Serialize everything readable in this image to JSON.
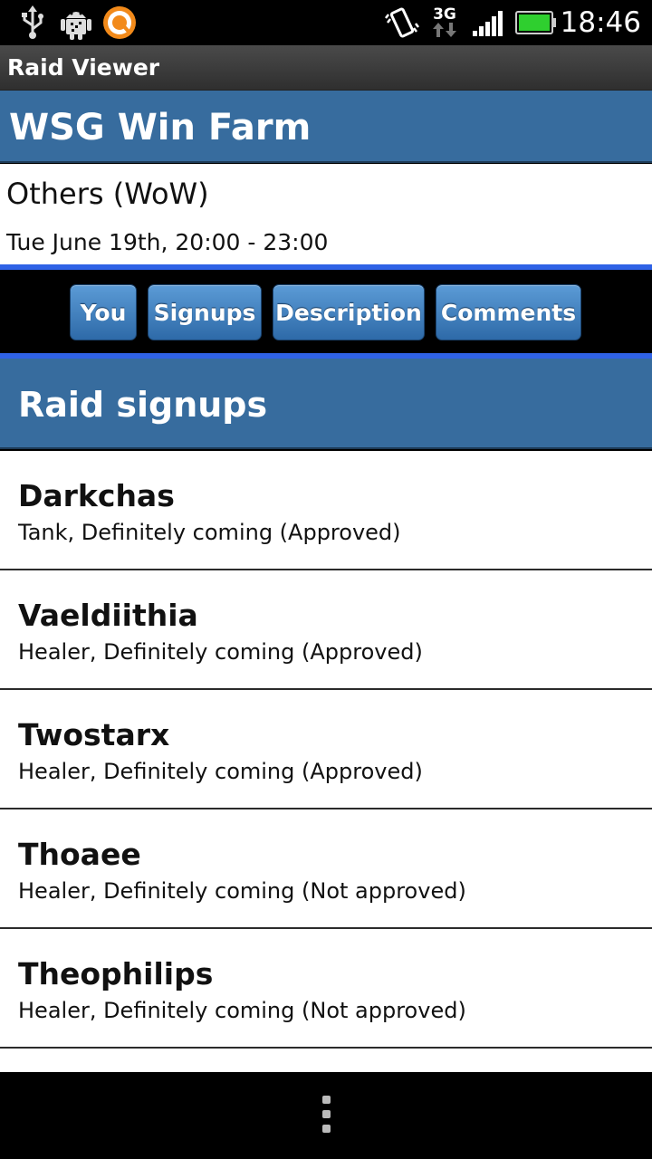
{
  "status_bar": {
    "icons": [
      "usb-icon",
      "android-debug-icon",
      "app-notification-icon",
      "vibrate-icon",
      "network-3g-icon",
      "signal-icon",
      "battery-icon"
    ],
    "network_label": "3G",
    "time": "18:46"
  },
  "app": {
    "title": "Raid Viewer"
  },
  "event": {
    "title": "WSG Win Farm",
    "game": "Others (WoW)",
    "datetime": "Tue June 19th, 20:00 - 23:00"
  },
  "tabs": [
    {
      "label": "You"
    },
    {
      "label": "Signups"
    },
    {
      "label": "Description"
    },
    {
      "label": "Comments"
    }
  ],
  "section": {
    "title": "Raid signups"
  },
  "signups": [
    {
      "name": "Darkchas",
      "status": "Tank, Definitely coming (Approved)"
    },
    {
      "name": "Vaeldiithia",
      "status": "Healer, Definitely coming (Approved)"
    },
    {
      "name": "Twostarx",
      "status": "Healer, Definitely coming (Approved)"
    },
    {
      "name": "Thoaee",
      "status": "Healer, Definitely coming (Not approved)"
    },
    {
      "name": "Theophilips",
      "status": "Healer, Definitely coming (Not approved)"
    }
  ],
  "colors": {
    "header_blue": "#376c9e",
    "accent_blue": "#2f62e6",
    "button_blue": "#3d7fc0"
  }
}
